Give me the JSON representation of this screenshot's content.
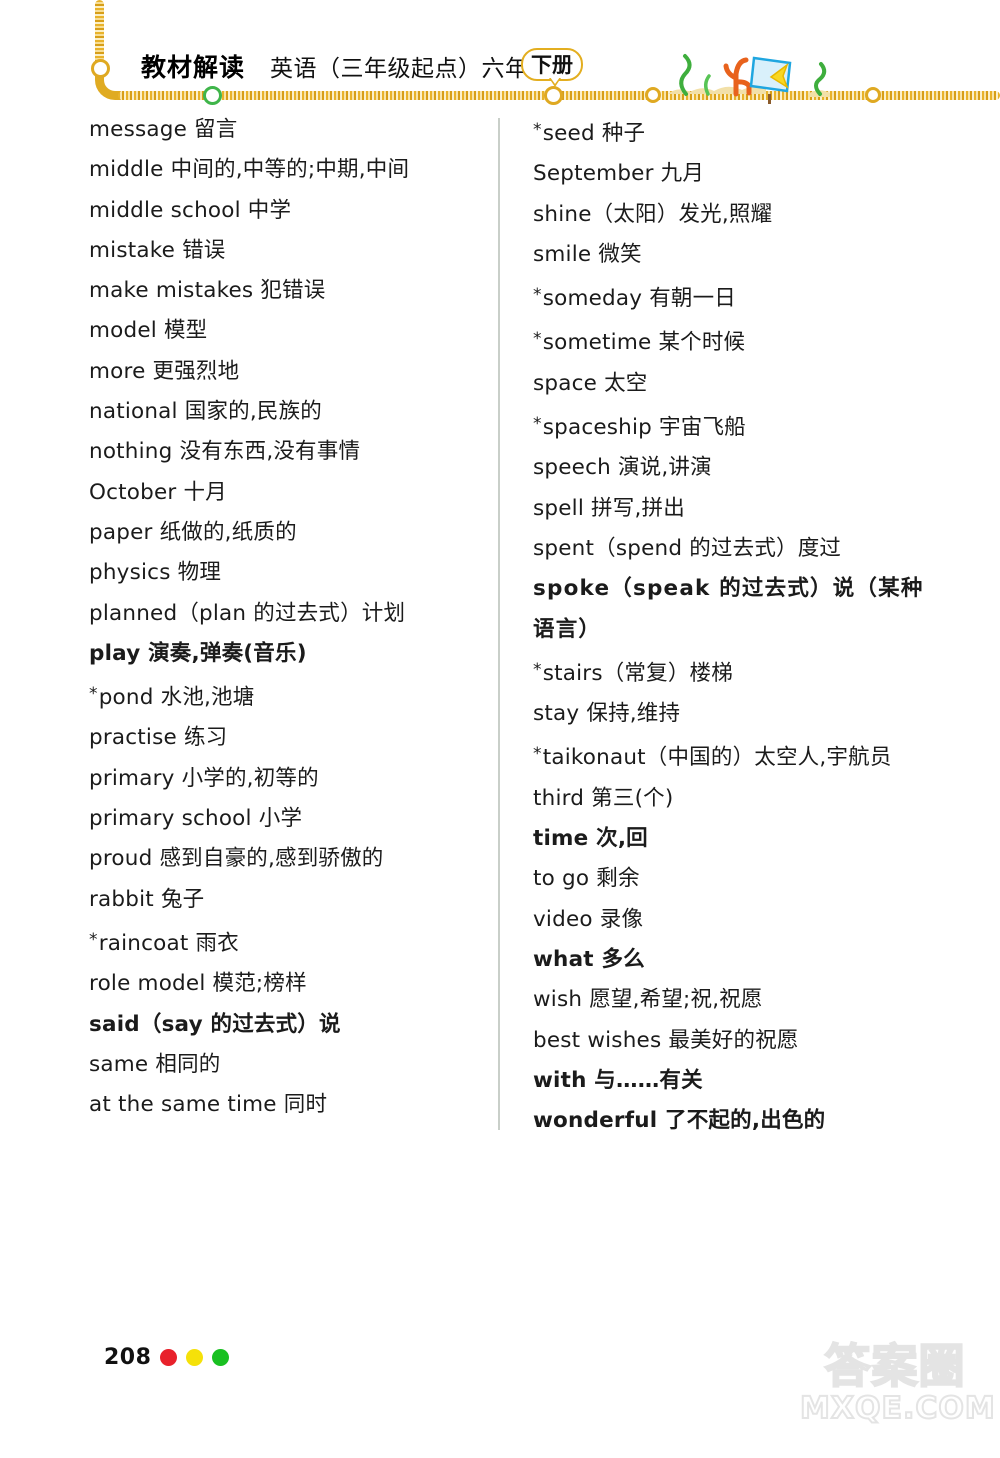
{
  "header": {
    "book_title": "教材解读",
    "subject_line": "英语（三年级起点）六年级",
    "volume_badge": "下册",
    "decor_icons": [
      "seaweed-icon",
      "coral-icon",
      "fish-sign-icon",
      "seaweed-icon"
    ]
  },
  "word_list": {
    "left_column": [
      {
        "text": "message 留言",
        "bold": false,
        "starred": false
      },
      {
        "text": "middle 中间的,中等的;中期,中间",
        "bold": false,
        "starred": false
      },
      {
        "text": "middle school 中学",
        "bold": false,
        "starred": false
      },
      {
        "text": "mistake 错误",
        "bold": false,
        "starred": false
      },
      {
        "text": "make mistakes 犯错误",
        "bold": false,
        "starred": false
      },
      {
        "text": "model 模型",
        "bold": false,
        "starred": false
      },
      {
        "text": "more 更强烈地",
        "bold": false,
        "starred": false
      },
      {
        "text": "national 国家的,民族的",
        "bold": false,
        "starred": false
      },
      {
        "text": "nothing 没有东西,没有事情",
        "bold": false,
        "starred": false
      },
      {
        "text": "October 十月",
        "bold": false,
        "starred": false
      },
      {
        "text": "paper 纸做的,纸质的",
        "bold": false,
        "starred": false
      },
      {
        "text": "physics 物理",
        "bold": false,
        "starred": false
      },
      {
        "text": "planned（plan 的过去式）计划",
        "bold": false,
        "starred": false
      },
      {
        "text": "play 演奏,弹奏(音乐)",
        "bold": true,
        "starred": false
      },
      {
        "text": "pond 水池,池塘",
        "bold": false,
        "starred": true
      },
      {
        "text": "practise 练习",
        "bold": false,
        "starred": false
      },
      {
        "text": "primary 小学的,初等的",
        "bold": false,
        "starred": false
      },
      {
        "text": "primary school 小学",
        "bold": false,
        "starred": false
      },
      {
        "text": "proud 感到自豪的,感到骄傲的",
        "bold": false,
        "starred": false
      },
      {
        "text": "rabbit 兔子",
        "bold": false,
        "starred": false
      },
      {
        "text": "raincoat 雨衣",
        "bold": false,
        "starred": true
      },
      {
        "text": "role model 模范;榜样",
        "bold": false,
        "starred": false
      },
      {
        "text": "said（say 的过去式）说",
        "bold": true,
        "starred": false
      },
      {
        "text": "same 相同的",
        "bold": false,
        "starred": false
      },
      {
        "text": "at the same time 同时",
        "bold": false,
        "starred": false
      }
    ],
    "right_column": [
      {
        "text": "seed 种子",
        "bold": false,
        "starred": true
      },
      {
        "text": "September 九月",
        "bold": false,
        "starred": false
      },
      {
        "text": "shine（太阳）发光,照耀",
        "bold": false,
        "starred": false
      },
      {
        "text": "smile 微笑",
        "bold": false,
        "starred": false
      },
      {
        "text": "someday 有朝一日",
        "bold": false,
        "starred": true
      },
      {
        "text": "sometime 某个时候",
        "bold": false,
        "starred": true
      },
      {
        "text": "space 太空",
        "bold": false,
        "starred": false
      },
      {
        "text": "spaceship 宇宙飞船",
        "bold": false,
        "starred": true
      },
      {
        "text": "speech 演说,讲演",
        "bold": false,
        "starred": false
      },
      {
        "text": "spell 拼写,拼出",
        "bold": false,
        "starred": false
      },
      {
        "text": "spent（spend 的过去式）度过",
        "bold": false,
        "starred": false
      },
      {
        "text": "spoke（speak 的过去式）说（某种语言）",
        "bold": true,
        "starred": false,
        "wrap": true
      },
      {
        "text": "stairs（常复）楼梯",
        "bold": false,
        "starred": true
      },
      {
        "text": "stay 保持,维持",
        "bold": false,
        "starred": false
      },
      {
        "text": "taikonaut（中国的）太空人,宇航员",
        "bold": false,
        "starred": true
      },
      {
        "text": "third 第三(个)",
        "bold": false,
        "starred": false
      },
      {
        "text": "time 次,回",
        "bold": true,
        "starred": false
      },
      {
        "text": "to go 剩余",
        "bold": false,
        "starred": false
      },
      {
        "text": "video 录像",
        "bold": false,
        "starred": false
      },
      {
        "text": "what 多么",
        "bold": true,
        "starred": false
      },
      {
        "text": "wish 愿望,希望;祝,祝愿",
        "bold": false,
        "starred": false
      },
      {
        "text": "best wishes 最美好的祝愿",
        "bold": false,
        "starred": false
      },
      {
        "text": "with 与……有关",
        "bold": true,
        "starred": false
      },
      {
        "text": "wonderful 了不起的,出色的",
        "bold": true,
        "starred": false
      }
    ]
  },
  "footer": {
    "page_number": "208",
    "dot_colors": [
      "#e8212b",
      "#f5e109",
      "#19c021"
    ]
  },
  "watermark": {
    "chinese": "答案圈",
    "domain": "MXQE.COM"
  }
}
